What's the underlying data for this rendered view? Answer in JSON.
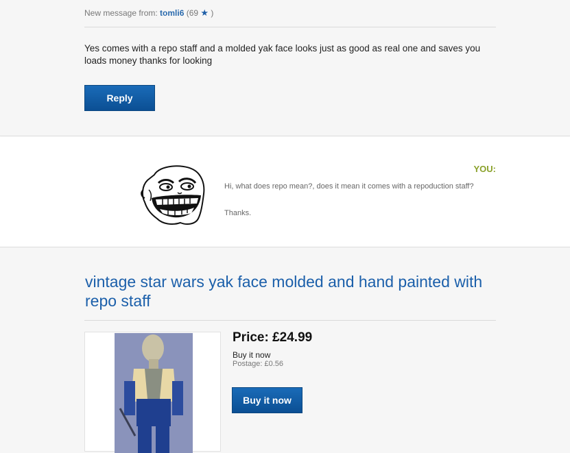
{
  "message": {
    "from_prefix": "New message from:",
    "sender": "tomli6",
    "feedback_open": "(69",
    "feedback_close": ")",
    "star_icon": "star-icon",
    "body": "Yes comes with a repo staff and a molded yak face looks just as good as real one and saves you loads money thanks for looking",
    "reply_label": "Reply"
  },
  "my_message": {
    "you_label": "YOU:",
    "text": "Hi, what does repo mean?, does it mean it comes with a repoduction staff?",
    "thanks": "Thanks."
  },
  "item": {
    "title": "vintage star wars yak face molded and hand painted with repo staff",
    "price": "Price: £24.99",
    "buy_type": "Buy it now",
    "postage": "Postage: £0.56",
    "buy_label": "Buy it now"
  },
  "colors": {
    "link_blue": "#1b5faa",
    "button_blue": "#0b5aa5",
    "you_green": "#8aa12a"
  }
}
